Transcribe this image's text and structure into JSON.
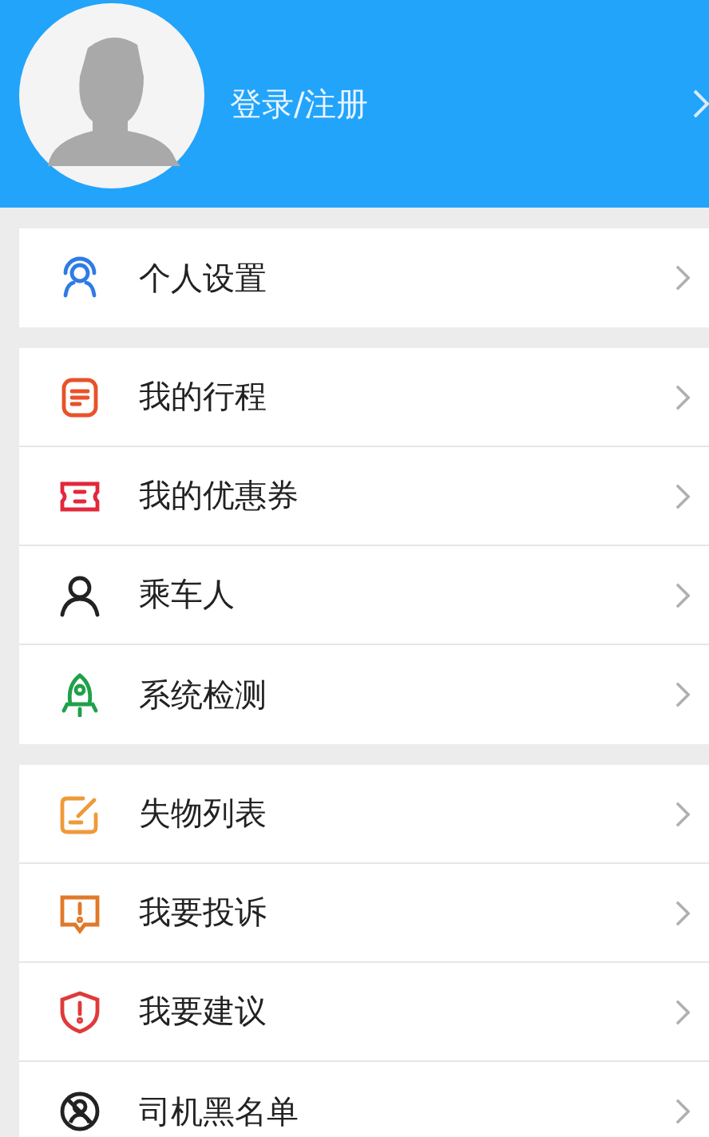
{
  "header": {
    "login_label": "登录/注册"
  },
  "groups": [
    {
      "items": [
        {
          "label": "个人设置"
        }
      ]
    },
    {
      "items": [
        {
          "label": "我的行程"
        },
        {
          "label": "我的优惠券"
        },
        {
          "label": "乘车人"
        },
        {
          "label": "系统检测"
        }
      ]
    },
    {
      "items": [
        {
          "label": "失物列表"
        },
        {
          "label": "我要投诉"
        },
        {
          "label": "我要建议"
        },
        {
          "label": "司机黑名单"
        }
      ]
    }
  ]
}
